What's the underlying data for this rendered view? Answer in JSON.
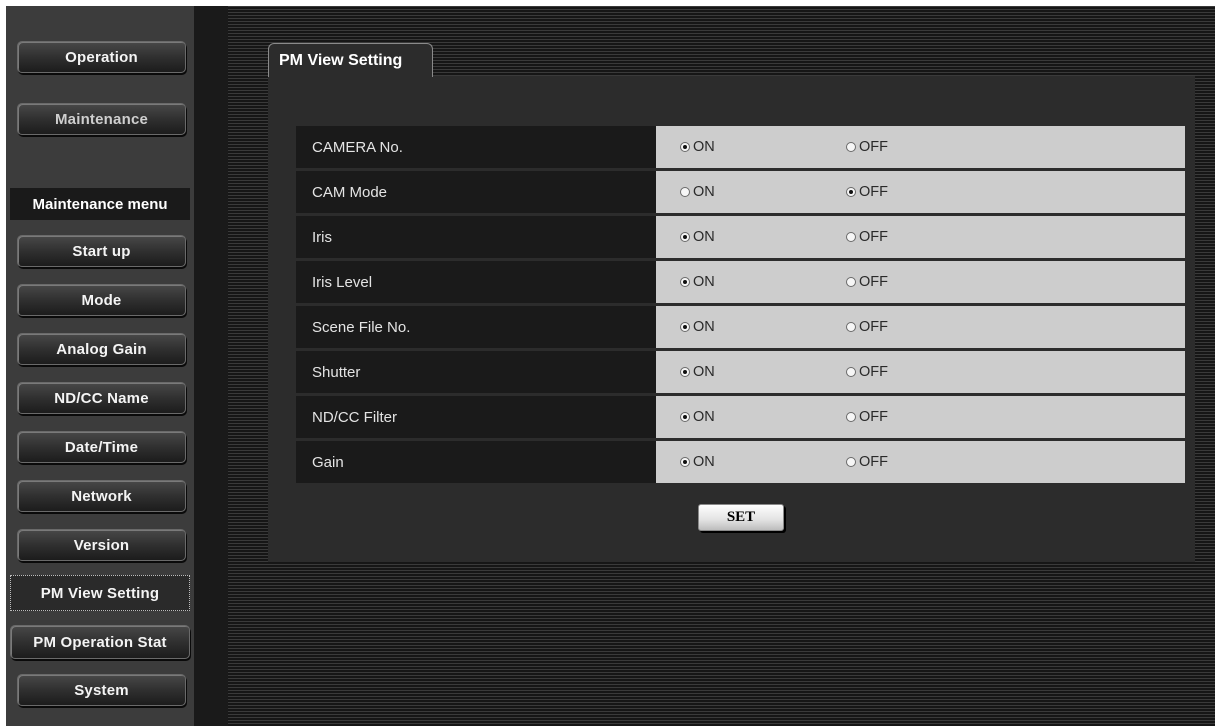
{
  "sidebar": {
    "top_buttons": [
      "Operation",
      "Maintenance"
    ],
    "menu_heading": "Maintenance menu",
    "menu_items": [
      "Start up",
      "Mode",
      "Analog Gain",
      "ND/CC Name",
      "Date/Time",
      "Network",
      "Version",
      "PM View Setting",
      "PM Operation Stat",
      "System"
    ],
    "active_item": "PM View Setting"
  },
  "panel": {
    "title": "PM View Setting",
    "on_label": "ON",
    "off_label": "OFF",
    "rows": [
      {
        "label": "CAMERA No.",
        "value": "ON"
      },
      {
        "label": "CAM Mode",
        "value": "OFF"
      },
      {
        "label": "Iris",
        "value": "ON"
      },
      {
        "label": "Iris Level",
        "value": "ON"
      },
      {
        "label": "Scene File No.",
        "value": "ON"
      },
      {
        "label": "Shutter",
        "value": "ON"
      },
      {
        "label": "ND/CC Filter",
        "value": "ON"
      },
      {
        "label": "Gain",
        "value": "ON"
      }
    ],
    "set_label": "SET"
  }
}
